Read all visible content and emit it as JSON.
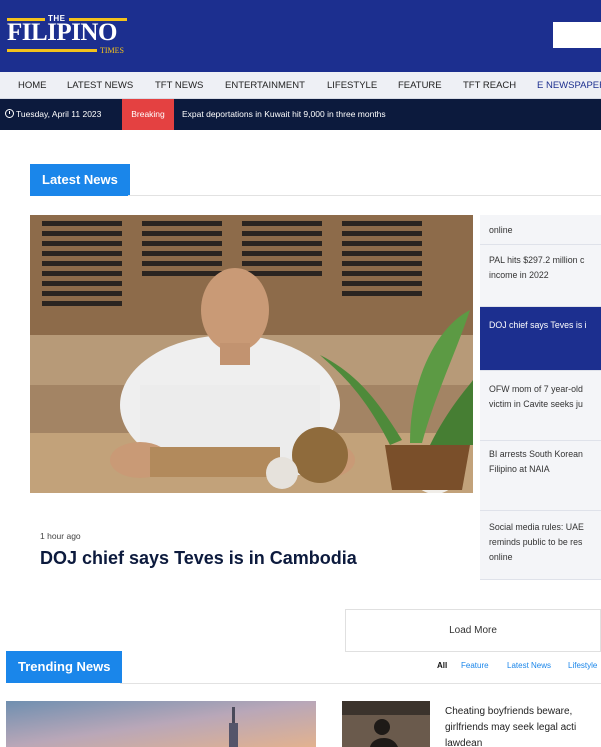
{
  "brand": {
    "the": "THE",
    "name": "FILIPINO",
    "times": "TIMES"
  },
  "nav": [
    {
      "label": "HOME"
    },
    {
      "label": "LATEST NEWS"
    },
    {
      "label": "TFT NEWS"
    },
    {
      "label": "ENTERTAINMENT"
    },
    {
      "label": "LIFESTYLE"
    },
    {
      "label": "FEATURE"
    },
    {
      "label": "TFT REACH"
    },
    {
      "label": "E NEWSPAPER"
    }
  ],
  "ticker": {
    "date": "Tuesday, April 11 2023",
    "badge": "Breaking",
    "headline": "Expat deportations in Kuwait hit 9,000 in three months"
  },
  "latest": {
    "heading": "Latest News",
    "time_ago": "1 hour ago",
    "title": "DOJ chief says Teves is in Cambodia"
  },
  "side_list": [
    {
      "lines": [
        "online"
      ]
    },
    {
      "lines": [
        "PAL hits $297.2 million c",
        "income in 2022"
      ]
    },
    {
      "lines": [
        "DOJ chief says Teves is i"
      ]
    },
    {
      "lines": [
        "OFW mom of 7 year-old",
        "victim in Cavite seeks ju"
      ]
    },
    {
      "lines": [
        "BI arrests South Korean",
        "Filipino at NAIA"
      ]
    },
    {
      "lines": [
        "Social media rules: UAE",
        "reminds public to be res",
        "online"
      ]
    }
  ],
  "load_more": "Load More",
  "trending": {
    "heading": "Trending News",
    "tabs": [
      "All",
      "Feature",
      "Latest News",
      "Lifestyle"
    ],
    "item_title_lines": [
      "Cheating boyfriends beware,",
      "girlfriends may seek legal acti",
      "lawdean"
    ]
  },
  "colors": {
    "header_blue": "#1c2f8f",
    "ticker_navy": "#0c1a3d",
    "accent_blue": "#1a86ea",
    "breaking_red": "#e44141",
    "logo_gold": "#f3c21b"
  }
}
